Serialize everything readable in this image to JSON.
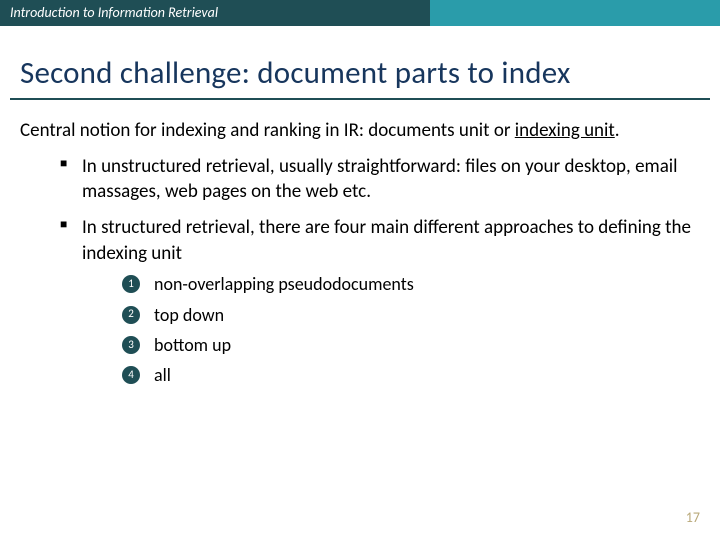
{
  "topbar": {
    "course": "Introduction to Information Retrieval"
  },
  "title": "Second challenge: document parts to index",
  "intro": {
    "pre": "Central notion for indexing and ranking in IR: documents unit or ",
    "term": "indexing unit",
    "post": "."
  },
  "bullets": [
    "In unstructured retrieval, usually straightforward: files on your desktop, email massages, web pages on the web etc.",
    "In structured retrieval, there are four main different approaches to defining the indexing unit"
  ],
  "approaches": [
    {
      "n": "1",
      "label": "non-overlapping pseudodocuments"
    },
    {
      "n": "2",
      "label": "top down"
    },
    {
      "n": "3",
      "label": "bottom up"
    },
    {
      "n": "4",
      "label": "all"
    }
  ],
  "page_number": "17"
}
